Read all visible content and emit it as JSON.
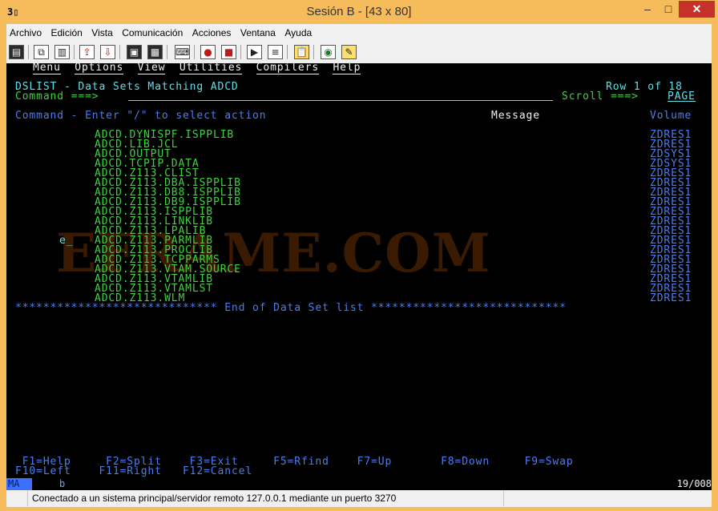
{
  "window": {
    "title": "Sesión B - [43 x 80]",
    "app_icon": "3▯",
    "buttons": {
      "minimize": "–",
      "maximize": "□",
      "close": "✕"
    }
  },
  "menubar": [
    "Archivo",
    "Edición",
    "Vista",
    "Comunicación",
    "Acciones",
    "Ventana",
    "Ayuda"
  ],
  "toolbar": [
    {
      "name": "print-screen-icon",
      "glyph": "▤"
    },
    {
      "name": "copy-icon",
      "glyph": "⧉"
    },
    {
      "name": "paste-icon",
      "glyph": "▥"
    },
    {
      "name": "send-file-icon",
      "glyph": "⇪"
    },
    {
      "name": "receive-file-icon",
      "glyph": "⇩"
    },
    {
      "name": "display-session-icon",
      "glyph": "▣"
    },
    {
      "name": "screen-icon",
      "glyph": "▦"
    },
    {
      "name": "keyboard-map-icon",
      "glyph": "⌨"
    },
    {
      "name": "record-macro-icon",
      "glyph": "●"
    },
    {
      "name": "stop-macro-icon",
      "glyph": "■"
    },
    {
      "name": "play-macro-icon",
      "glyph": "▶"
    },
    {
      "name": "macro-list-icon",
      "glyph": "≡"
    },
    {
      "name": "clipboard-icon",
      "glyph": "📋"
    },
    {
      "name": "globe-icon",
      "glyph": "◉"
    },
    {
      "name": "help-icon",
      "glyph": "✎"
    }
  ],
  "terminal": {
    "action_bar": {
      "items": [
        "Menu",
        "Options",
        "View",
        "Utilities",
        "Compilers",
        "Help"
      ]
    },
    "panel_title": "DSLIST - Data Sets Matching ADCD",
    "row_info": "Row 1 of 18",
    "command_label": "Command ===>",
    "scroll_label": "Scroll ===>",
    "scroll_value": "PAGE",
    "header": {
      "command": "Command - Enter \"/\" to select action",
      "message": "Message",
      "volume": "Volume"
    },
    "datasets": [
      {
        "cmd": "",
        "name": "ADCD.DYNISPF.ISPPLIB",
        "volume": "ZDRES1"
      },
      {
        "cmd": "",
        "name": "ADCD.LIB.JCL",
        "volume": "ZDRES1"
      },
      {
        "cmd": "",
        "name": "ADCD.OUTPUT",
        "volume": "ZDSYS1"
      },
      {
        "cmd": "",
        "name": "ADCD.TCPIP.DATA",
        "volume": "ZDSYS1"
      },
      {
        "cmd": "",
        "name": "ADCD.Z113.CLIST",
        "volume": "ZDRES1"
      },
      {
        "cmd": "",
        "name": "ADCD.Z113.DBA.ISPPLIB",
        "volume": "ZDRES1"
      },
      {
        "cmd": "",
        "name": "ADCD.Z113.DB8.ISPPLIB",
        "volume": "ZDRES1"
      },
      {
        "cmd": "",
        "name": "ADCD.Z113.DB9.ISPPLIB",
        "volume": "ZDRES1"
      },
      {
        "cmd": "",
        "name": "ADCD.Z113.ISPPLIB",
        "volume": "ZDRES1"
      },
      {
        "cmd": "",
        "name": "ADCD.Z113.LINKLIB",
        "volume": "ZDRES1"
      },
      {
        "cmd": "",
        "name": "ADCD.Z113.LPALIB",
        "volume": "ZDRES1"
      },
      {
        "cmd": "e_",
        "name": "ADCD.Z113.PARMLIB",
        "volume": "ZDRES1"
      },
      {
        "cmd": "",
        "name": "ADCD.Z113.PROCLIB",
        "volume": "ZDRES1"
      },
      {
        "cmd": "",
        "name": "ADCD.Z113.TCPPARMS",
        "volume": "ZDRES1"
      },
      {
        "cmd": "",
        "name": "ADCD.Z113.VTAM.SOURCE",
        "volume": "ZDRES1"
      },
      {
        "cmd": "",
        "name": "ADCD.Z113.VTAMLIB",
        "volume": "ZDRES1"
      },
      {
        "cmd": "",
        "name": "ADCD.Z113.VTAMLST",
        "volume": "ZDRES1"
      },
      {
        "cmd": "",
        "name": "ADCD.Z113.WLM",
        "volume": "ZDRES1"
      }
    ],
    "end_line": "***************************** End of Data Set list ****************************",
    "fkeys_line1": " F1=Help     F2=Split    F3=Exit     F5=Rfind    F7=Up       F8=Down     F9=Swap",
    "fkeys_line2": "F10=Left    F11=Right   F12=Cancel",
    "watermark": "EFRAME.COM"
  },
  "oia": {
    "mode": "MA",
    "indicator": "b",
    "cursor_pos": "19/008"
  },
  "status_bar": {
    "text": "Conectado a un sistema principal/servidor remoto 127.0.0.1 mediante un puerto 3270"
  }
}
